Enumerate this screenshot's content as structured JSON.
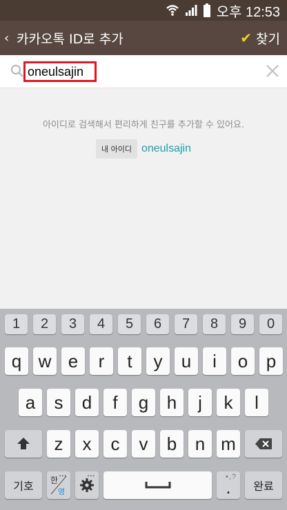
{
  "status_bar": {
    "time": "오후 12:53",
    "icons": [
      "wifi-icon",
      "signal-icon",
      "battery-icon"
    ]
  },
  "app_bar": {
    "back_label": "‹",
    "title": "카카오톡 ID로 추가",
    "find_label": "찾기",
    "find_icon": "✔"
  },
  "search": {
    "value": "oneulsajin",
    "placeholder": "",
    "clear_icon": "close-icon"
  },
  "content": {
    "helper_text": "아이디로 검색해서 편리하게 친구를 추가할 수 있어요.",
    "my_id_label": "내 아이디",
    "my_id_value": "oneulsajin"
  },
  "keyboard": {
    "numbers": [
      "1",
      "2",
      "3",
      "4",
      "5",
      "6",
      "7",
      "8",
      "9",
      "0"
    ],
    "row1": [
      "q",
      "w",
      "e",
      "r",
      "t",
      "y",
      "u",
      "i",
      "o",
      "p"
    ],
    "row2": [
      "a",
      "s",
      "d",
      "f",
      "g",
      "h",
      "j",
      "k",
      "l"
    ],
    "row3": [
      "z",
      "x",
      "c",
      "v",
      "b",
      "n",
      "m"
    ],
    "symbols_label": "기호",
    "lang_label_top": "한",
    "lang_label_bottom": "영",
    "period_label": ".",
    "done_label": "완료"
  },
  "colors": {
    "status_bg": "#4a3b33",
    "appbar_bg": "#574740",
    "accent_check": "#f2d21b",
    "highlight_box": "#e0141e",
    "id_link": "#1a9eac"
  }
}
